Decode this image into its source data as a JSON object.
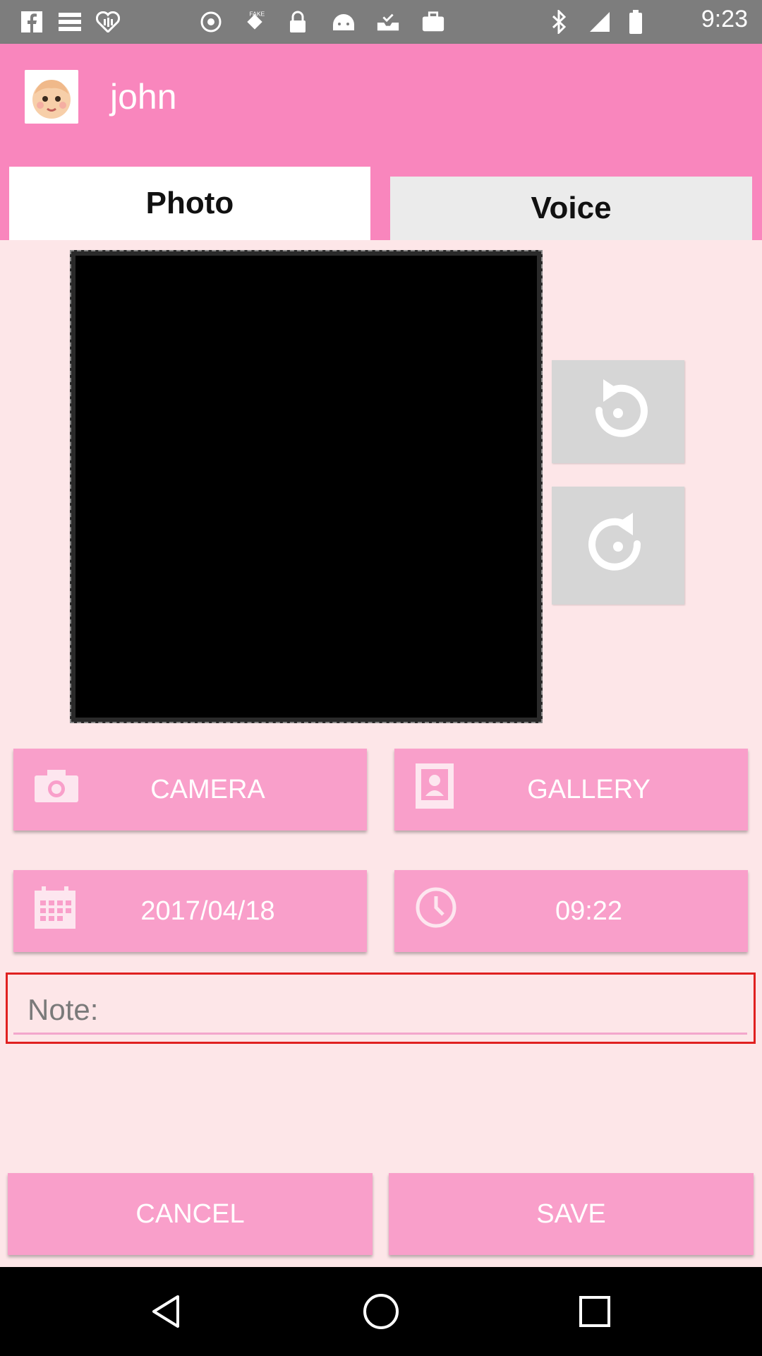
{
  "status_bar": {
    "time": "9:23",
    "icons": [
      "facebook-icon",
      "menu-icon",
      "iheart-icon",
      "notification-icon",
      "fake-gps-icon",
      "lock-icon",
      "android-icon",
      "inbox-check-icon",
      "work-icon",
      "bluetooth-icon",
      "signal-icon",
      "battery-icon"
    ]
  },
  "app_bar": {
    "user_name": "john",
    "avatar_icon": "baby-face-icon"
  },
  "tabs": [
    {
      "label": "Photo",
      "selected": true
    },
    {
      "label": "Voice",
      "selected": false
    }
  ],
  "photo": {
    "rotate_left_icon": "rotate-ccw-icon",
    "rotate_right_icon": "rotate-cw-icon"
  },
  "buttons": {
    "camera": "CAMERA",
    "gallery": "GALLERY",
    "date": "2017/04/18",
    "time": "09:22",
    "cancel": "CANCEL",
    "save": "SAVE"
  },
  "note": {
    "placeholder": "Note:",
    "value": ""
  },
  "colors": {
    "accent": "#f986bd",
    "button": "#f99fca",
    "background": "#fde6e8",
    "focus_border": "#e02020"
  }
}
